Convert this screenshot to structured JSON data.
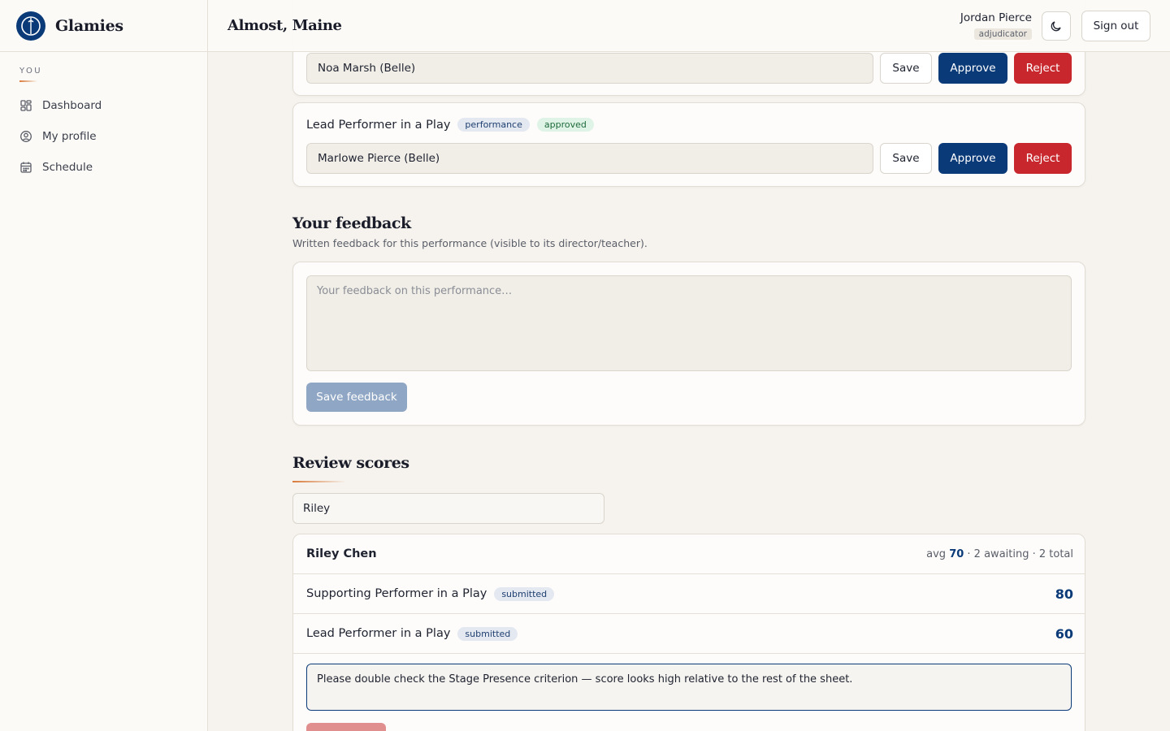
{
  "brand": {
    "name": "Glamies"
  },
  "sidebar": {
    "section_label": "YOU",
    "items": [
      {
        "label": "Dashboard",
        "icon": "dashboard-icon"
      },
      {
        "label": "My profile",
        "icon": "user-circle-icon"
      },
      {
        "label": "Schedule",
        "icon": "calendar-icon"
      }
    ]
  },
  "header": {
    "title": "Almost, Maine",
    "user_name": "Jordan Pierce",
    "user_role": "adjudicator",
    "theme_icon": "moon-icon",
    "signout_label": "Sign out"
  },
  "nominations": [
    {
      "value": "Noa Marsh (Belle)",
      "save_label": "Save",
      "approve_label": "Approve",
      "reject_label": "Reject"
    },
    {
      "category": "Lead Performer in a Play",
      "type_badge": "performance",
      "status_badge": "approved",
      "value": "Marlowe Pierce (Belle)",
      "save_label": "Save",
      "approve_label": "Approve",
      "reject_label": "Reject"
    }
  ],
  "feedback": {
    "heading": "Your feedback",
    "subtext": "Written feedback for this performance (visible to its director/teacher).",
    "placeholder": "Your feedback on this performance…",
    "save_label": "Save feedback"
  },
  "review": {
    "heading": "Review scores",
    "search_value": "Riley",
    "student": {
      "name": "Riley Chen",
      "avg_label": "avg",
      "avg": "70",
      "rest": "· 2 awaiting · 2 total"
    },
    "rows": [
      {
        "category": "Supporting Performer in a Play",
        "status": "submitted",
        "score": "80"
      },
      {
        "category": "Lead Performer in a Play",
        "status": "submitted",
        "score": "60"
      }
    ],
    "note": "Please double check the Stage Presence criterion — score looks high relative to the rest of the sheet."
  },
  "colors": {
    "accent": "#0b3a78",
    "danger": "#c8282d",
    "brand_orange": "#d97a3a"
  }
}
